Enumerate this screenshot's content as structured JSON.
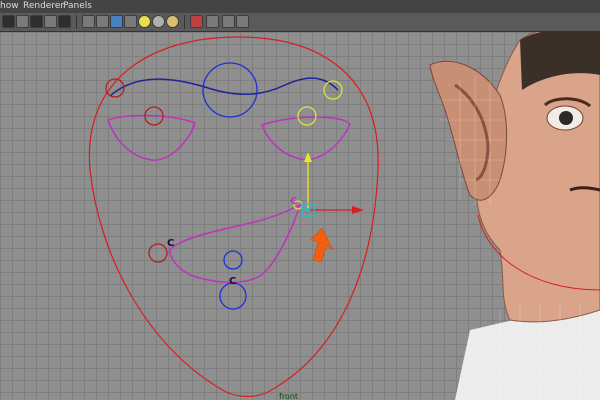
{
  "menu": {
    "items": [
      "how",
      "Renderer",
      "Panels"
    ]
  },
  "toolbar": {
    "icons": [
      "camera-icon",
      "render-icon",
      "wireframe-icon",
      "xray-icon",
      "texture-icon",
      "smooth-shade-icon",
      "flat-shade-icon",
      "wire-shade-icon",
      "light-icon",
      "ambient-icon",
      "sphere-icon",
      "isolate-icon",
      "layout-icon",
      "share-icon"
    ]
  },
  "viewport": {
    "camera_label": "front",
    "ctrl_labels": [
      "C",
      "C",
      "C"
    ]
  },
  "colors": {
    "face_outline": "#d81e1e",
    "brow_curve": "#20209a",
    "lip_curve": "#c030c0",
    "control_circle_blue": "#1f2fd8",
    "control_circle_yellow": "#e0e040",
    "control_circle_red": "#b02020",
    "manip_y": "#e8e820",
    "manip_x": "#d81e1e",
    "manip_center": "#20c0d0",
    "arrow": "#f06010",
    "skin": "#d9a48a",
    "shirt": "#ececec"
  }
}
